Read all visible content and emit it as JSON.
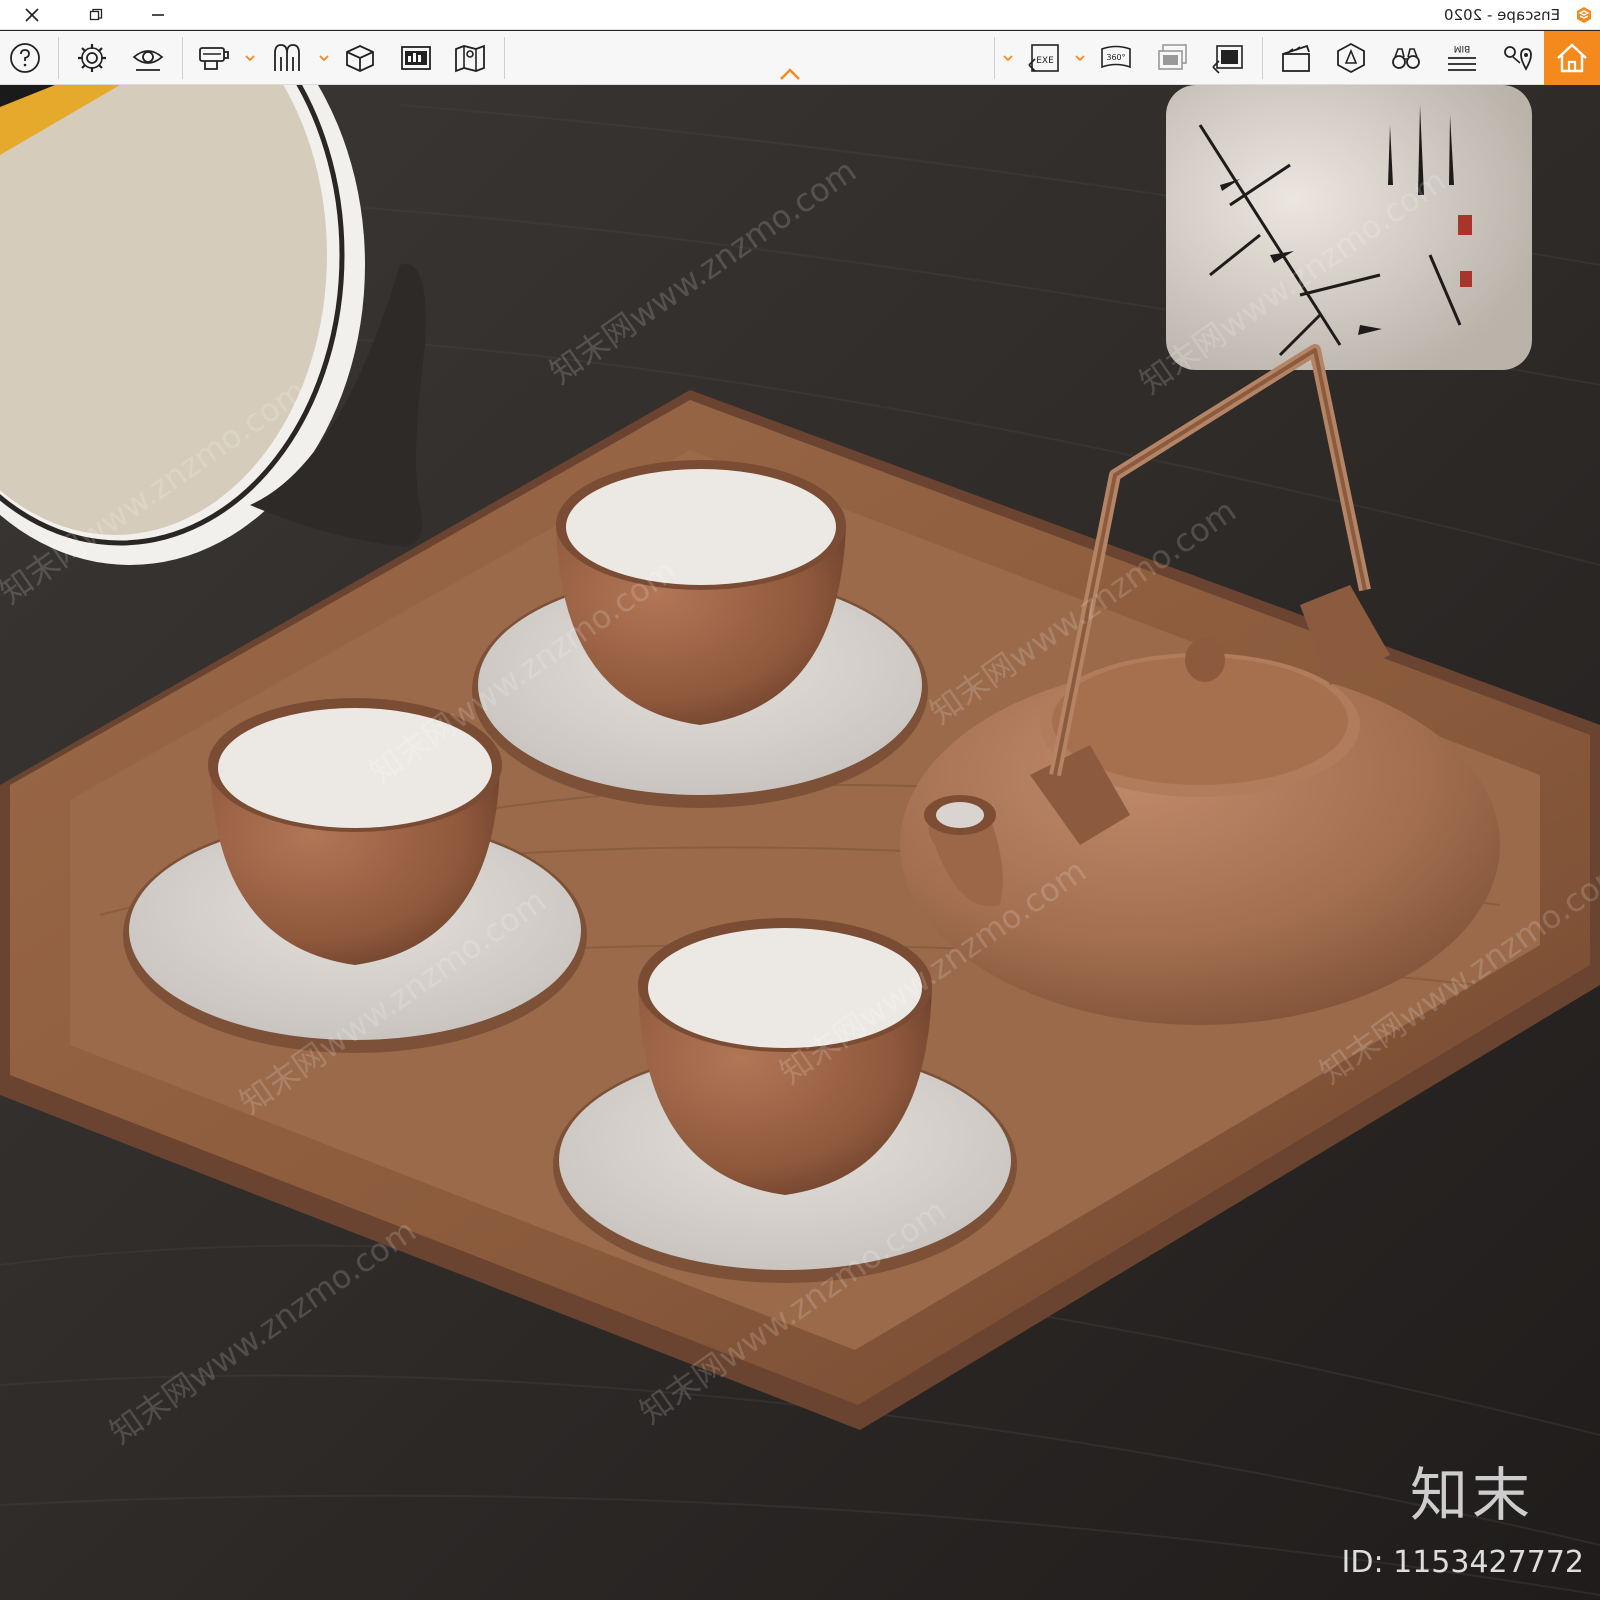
{
  "window": {
    "title": "Enscape - 2020",
    "controls": [
      "close-icon",
      "restore-icon",
      "minimize-icon"
    ]
  },
  "toolbar": {
    "left_icons": [
      "help-icon",
      "settings-icon",
      "visual-settings-icon",
      "vr-headset-icon",
      "asset-library-icon",
      "cube-view-icon",
      "render-image-icon",
      "map-icon"
    ],
    "right_icons": [
      "export-exe-icon",
      "panorama-360-icon",
      "batch-render-icon",
      "export-image-icon",
      "video-editor-icon",
      "collaborative-annotation-icon",
      "binoculars-icon",
      "bim-info-icon",
      "views-icon",
      "home-icon"
    ],
    "bim_label": "BIM",
    "exe_label": "EXE",
    "pano_label": "360°",
    "accent_color": "#f48a1e"
  },
  "viewport": {
    "watermark_brand": "知末",
    "asset_id": "ID: 1153427772",
    "watermark_text": "知末网www.znzmo.com"
  }
}
